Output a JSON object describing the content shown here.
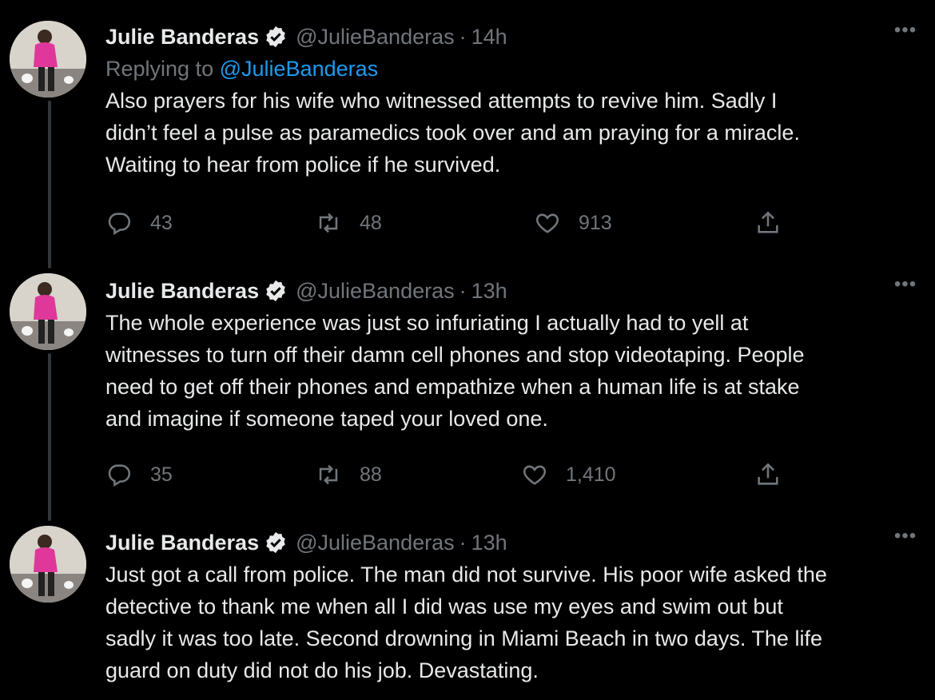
{
  "thread": [
    {
      "author_name": "Julie Banderas",
      "handle": "@JulieBanderas",
      "separator": "·",
      "time": "14h",
      "replying_label": "Replying to",
      "replying_to": "@JulieBanderas",
      "text": "Also prayers for his wife who witnessed attempts to revive him. Sadly I\ndidn’t feel a pulse as paramedics took over and am praying for a miracle.\nWaiting to hear from police if he survived.",
      "replies": "43",
      "retweets": "48",
      "likes": "913"
    },
    {
      "author_name": "Julie Banderas",
      "handle": "@JulieBanderas",
      "separator": "·",
      "time": "13h",
      "text": "The whole experience was just so infuriating I actually had to yell at\nwitnesses to turn off their damn cell phones and stop videotaping. People\nneed to get off their phones and empathize when a human life is at stake\nand imagine if someone taped your loved one.",
      "replies": "35",
      "retweets": "88",
      "likes": "1,410"
    },
    {
      "author_name": "Julie Banderas",
      "handle": "@JulieBanderas",
      "separator": "·",
      "time": "13h",
      "text": "Just got a call from police. The man did not survive. His poor wife asked the\ndetective to thank me when all I did was use my eyes and swim out but\nsadly it was too late. Second drowning in Miami Beach in two days. The life\nguard on duty did not do his job. Devastating."
    }
  ],
  "icons": {
    "verified": "verified-badge-icon",
    "more": "more-options-icon",
    "reply": "reply-icon",
    "retweet": "retweet-icon",
    "like": "heart-icon",
    "share": "share-icon"
  },
  "colors": {
    "background": "#000000",
    "text": "#e7e9ea",
    "muted": "#71767b",
    "link": "#1d9bf0",
    "thread_line": "#333639"
  }
}
